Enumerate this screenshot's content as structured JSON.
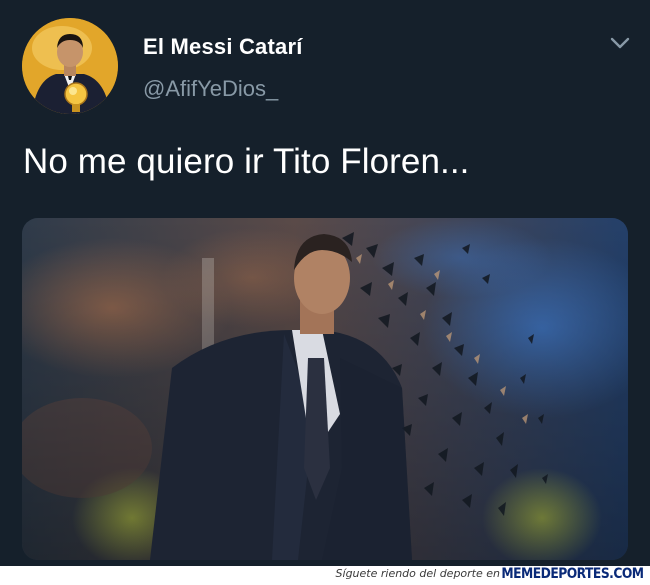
{
  "tweet": {
    "display_name": "El Messi Catarí",
    "handle": "@AfifYeDios_",
    "text": "No me quiero ir Tito Floren...",
    "avatar_icon": "profile-avatar",
    "menu_icon": "chevron-down-icon"
  },
  "colors": {
    "background": "#15202b",
    "name": "#ffffff",
    "handle": "#8899a6",
    "brand": "#0a2a78"
  },
  "footer": {
    "caption": "Síguete riendo del deporte en",
    "brand": "MEMEDEPORTES.COM"
  }
}
